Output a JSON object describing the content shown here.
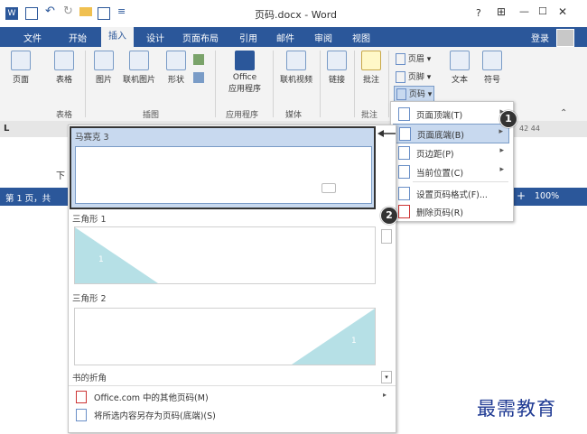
{
  "titlebar": {
    "title": "页码.docx - Word",
    "help": "?",
    "ribbon_options": "⊞",
    "minimize": "—",
    "maximize": "☐",
    "close": "✕"
  },
  "tabs": [
    "文件",
    "开始",
    "插入",
    "设计",
    "页面布局",
    "引用",
    "邮件",
    "审阅",
    "视图"
  ],
  "active_tab": "插入",
  "login": "登录",
  "ribbon": {
    "buttons": [
      {
        "label": "页面"
      },
      {
        "label": "表格"
      },
      {
        "label": "图片"
      },
      {
        "label": "联机图片"
      },
      {
        "label": "形状"
      },
      {
        "label": "Office\n应用程序"
      },
      {
        "label": "联机视频"
      },
      {
        "label": "链接"
      },
      {
        "label": "批注"
      },
      {
        "label": "文本"
      },
      {
        "label": "符号"
      }
    ],
    "groups": [
      "表格",
      "插图",
      "应用程序",
      "媒体",
      "批注"
    ],
    "header_footer": {
      "header": "页眉",
      "footer": "页脚",
      "page_number": "页码"
    }
  },
  "page_number_menu": {
    "items": [
      {
        "label": "页面顶端(T)",
        "submenu": true
      },
      {
        "label": "页面底端(B)",
        "submenu": true,
        "selected": true
      },
      {
        "label": "页边距(P)",
        "submenu": true
      },
      {
        "label": "当前位置(C)",
        "submenu": true
      },
      {
        "label": "设置页码格式(F)...",
        "submenu": false
      },
      {
        "label": "删除页码(R)",
        "submenu": false
      }
    ]
  },
  "gallery": {
    "items": [
      {
        "title": "马赛克 3"
      },
      {
        "title": "三角形 1"
      },
      {
        "title": "三角形 2"
      }
    ],
    "section_label": "书的折角",
    "footer_items": [
      {
        "label": "Office.com 中的其他页码(M)"
      },
      {
        "label": "将所选内容另存为页码(底端)(S)"
      }
    ]
  },
  "status": {
    "page": "第 1 页，共",
    "zoom": "100%",
    "zoom_plus": "+"
  },
  "doc_text": "下",
  "ruler_marks": "42  44",
  "callouts": [
    "1",
    "2"
  ],
  "watermark": "最需教育",
  "colors": {
    "accent": "#2b579a",
    "menu_highlight": "#c8d9ef",
    "triangle": "#b6e0e6"
  }
}
